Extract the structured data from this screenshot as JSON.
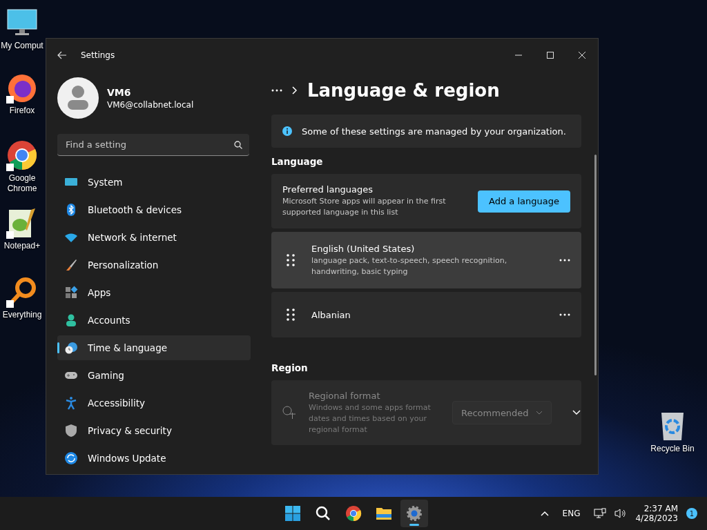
{
  "desktop_icons": [
    {
      "label": "My Comput",
      "kind": "computer",
      "shortcut": false
    },
    {
      "label": "Firefox",
      "kind": "firefox",
      "shortcut": true
    },
    {
      "label": "Google Chrome",
      "kind": "chrome",
      "shortcut": true
    },
    {
      "label": "Notepad+",
      "kind": "notepad",
      "shortcut": true
    },
    {
      "label": "Everything",
      "kind": "everything",
      "shortcut": true
    }
  ],
  "recycle_bin": {
    "label": "Recycle Bin"
  },
  "window": {
    "title": "Settings",
    "profile": {
      "name": "VM6",
      "email": "VM6@collabnet.local"
    },
    "search": {
      "placeholder": "Find a setting"
    },
    "nav": [
      {
        "label": "System",
        "kind": "system",
        "selected": false
      },
      {
        "label": "Bluetooth & devices",
        "kind": "bluetooth",
        "selected": false
      },
      {
        "label": "Network & internet",
        "kind": "network",
        "selected": false
      },
      {
        "label": "Personalization",
        "kind": "brush",
        "selected": false
      },
      {
        "label": "Apps",
        "kind": "apps",
        "selected": false
      },
      {
        "label": "Accounts",
        "kind": "accounts",
        "selected": false
      },
      {
        "label": "Time & language",
        "kind": "time",
        "selected": true
      },
      {
        "label": "Gaming",
        "kind": "gaming",
        "selected": false
      },
      {
        "label": "Accessibility",
        "kind": "accessibility",
        "selected": false
      },
      {
        "label": "Privacy & security",
        "kind": "privacy",
        "selected": false
      },
      {
        "label": "Windows Update",
        "kind": "update",
        "selected": false
      }
    ],
    "page_title": "Language & region",
    "notice": "Some of these settings are managed by your organization.",
    "language_heading": "Language",
    "preferred": {
      "title": "Preferred languages",
      "description": "Microsoft Store apps will appear in the first supported language in this list",
      "button": "Add a language"
    },
    "languages": [
      {
        "name": "English (United States)",
        "features": "language pack, text-to-speech, speech recognition, handwriting, basic typing",
        "hovered": true
      },
      {
        "name": "Albanian",
        "hovered": false
      }
    ],
    "region_heading": "Region",
    "regional_format": {
      "title": "Regional format",
      "description": "Windows and some apps format dates and times based on your regional format",
      "value": "Recommended",
      "disabled": true
    }
  },
  "taskbar": {
    "apps": [
      {
        "kind": "start",
        "selected": false
      },
      {
        "kind": "search",
        "selected": false
      },
      {
        "kind": "chrome",
        "selected": false
      },
      {
        "kind": "explorer",
        "selected": false
      },
      {
        "kind": "settings",
        "selected": true
      }
    ],
    "language": "ENG",
    "time": "2:37 AM",
    "date": "4/28/2023",
    "notifications": "1"
  }
}
